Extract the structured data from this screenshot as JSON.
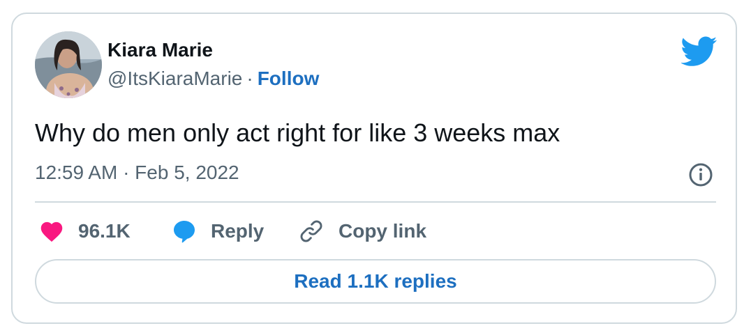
{
  "tweet": {
    "author_name": "Kiara Marie",
    "handle": "@ItsKiaraMarie",
    "separator": "·",
    "follow_label": "Follow",
    "text": "Why do men only act right for like 3 weeks max",
    "timestamp": "12:59 AM · Feb 5, 2022"
  },
  "actions": {
    "like_count": "96.1K",
    "reply_label": "Reply",
    "copy_link_label": "Copy link"
  },
  "read_replies_label": "Read 1.1K replies",
  "icons": {
    "brand": "twitter-bird-icon",
    "info": "info-icon",
    "like": "heart-icon",
    "reply": "speech-bubble-icon",
    "copy": "link-icon"
  },
  "colors": {
    "brand_blue": "#1d9bf0",
    "link_blue": "#1d6fc0",
    "heart_pink": "#f91880",
    "muted_text": "#536471",
    "border": "#cfd9de"
  }
}
